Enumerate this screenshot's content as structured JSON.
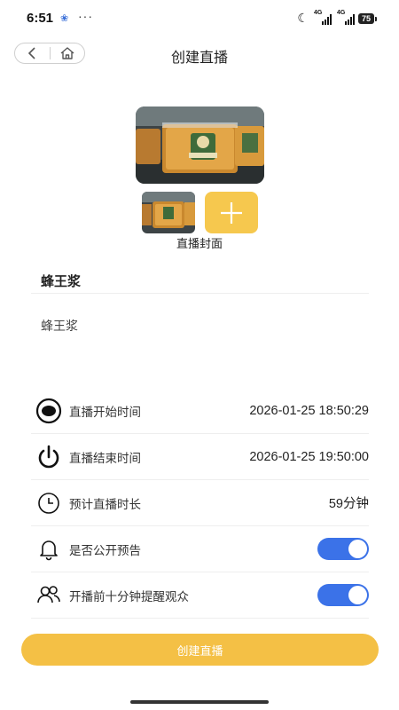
{
  "status_bar": {
    "time": "6:51",
    "dots": "···",
    "network_1": "4G",
    "network_2": "4G",
    "battery": "75"
  },
  "header": {
    "title": "创建直播"
  },
  "cover": {
    "label": "直播封面"
  },
  "form": {
    "title_value": "蜂王浆",
    "description_value": "蜂王浆"
  },
  "settings": [
    {
      "label": "直播开始时间",
      "value": "2026-01-25 18:50:29",
      "icon": "record-icon"
    },
    {
      "label": "直播结束时间",
      "value": "2026-01-25 19:50:00",
      "icon": "power-icon"
    },
    {
      "label": "预计直播时长",
      "value": "59分钟",
      "icon": "clock-icon"
    },
    {
      "label": "是否公开预告",
      "toggle_on": true,
      "icon": "bell-icon"
    },
    {
      "label": "开播前十分钟提醒观众",
      "toggle_on": true,
      "icon": "users-icon"
    }
  ],
  "actions": {
    "create_label": "创建直播"
  },
  "colors": {
    "accent_yellow": "#f4c045",
    "toggle_blue": "#3b72e8"
  }
}
